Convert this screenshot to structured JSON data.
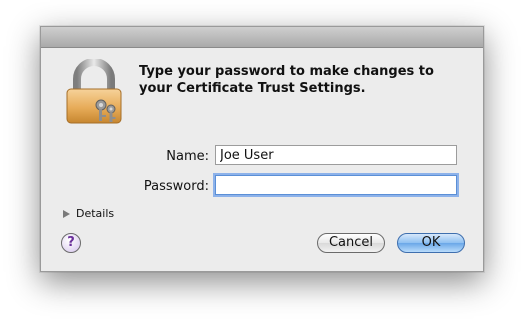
{
  "dialog": {
    "message": "Type your password to make changes to your Certificate Trust Settings.",
    "name_label": "Name:",
    "name_value": "Joe User",
    "password_label": "Password:",
    "password_value": "",
    "details_label": "Details",
    "help_label": "?",
    "cancel_label": "Cancel",
    "ok_label": "OK"
  },
  "icons": {
    "lock": "padlock-with-keys-icon",
    "disclosure": "disclosure-triangle-icon",
    "help": "help-icon"
  }
}
